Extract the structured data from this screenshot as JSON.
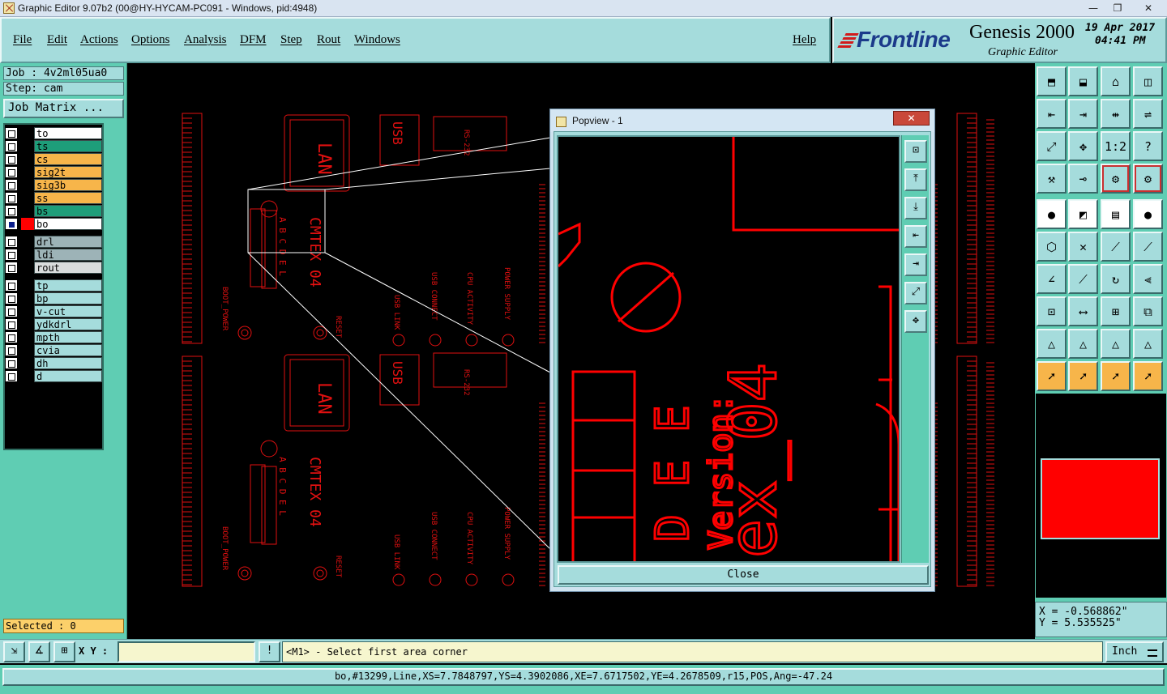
{
  "window": {
    "title": "Graphic Editor 9.07b2 (00@HY-HYCAM-PC091 - Windows, pid:4948)",
    "minimize_glyph": "—",
    "restore_glyph": "❐",
    "close_glyph": "✕"
  },
  "menu": {
    "items": [
      "File",
      "Edit",
      "Actions",
      "Options",
      "Analysis",
      "DFM",
      "Step",
      "Rout",
      "Windows"
    ],
    "help": "Help"
  },
  "brand": {
    "logo": "Frontline",
    "product": "Genesis 2000",
    "subtitle": "Graphic Editor",
    "date": "19 Apr 2017",
    "time": "04:41 PM"
  },
  "left": {
    "job": "Job : 4v2ml05ua0",
    "step": "Step: cam",
    "job_matrix": "Job Matrix ...",
    "layers": [
      {
        "name": "to",
        "color": "#ffffff"
      },
      {
        "name": "ts",
        "color": "#1e9e7a"
      },
      {
        "name": "cs",
        "color": "#f7b54a"
      },
      {
        "name": "sig2t",
        "color": "#f7b54a"
      },
      {
        "name": "sig3b",
        "color": "#f7b54a"
      },
      {
        "name": "ss",
        "color": "#f7b54a"
      },
      {
        "name": "bs",
        "color": "#1e9e7a"
      },
      {
        "name": "bo",
        "color": "#ffffff",
        "active": true
      },
      {
        "name": "drl",
        "color": "#9db3b7"
      },
      {
        "name": "ldi",
        "color": "#9db3b7"
      },
      {
        "name": "rout",
        "color": "#d9dcdc"
      },
      {
        "name": "tp",
        "color": "#a5dcdc"
      },
      {
        "name": "bp",
        "color": "#a5dcdc"
      },
      {
        "name": "v-cut",
        "color": "#a5dcdc"
      },
      {
        "name": "ydkdrl",
        "color": "#a5dcdc"
      },
      {
        "name": "mpth",
        "color": "#a5dcdc"
      },
      {
        "name": "cvia",
        "color": "#a5dcdc"
      },
      {
        "name": "dh",
        "color": "#a5dcdc"
      },
      {
        "name": "d",
        "color": "#a5dcdc"
      }
    ],
    "selected": "Selected : 0"
  },
  "popview": {
    "title": "Popview - 1",
    "close_label": "Close",
    "tools": [
      "⊡",
      "⤒",
      "⤓",
      "⇤",
      "⇥",
      "⤢",
      "✥"
    ]
  },
  "canvas": {
    "labels": {
      "lan": "LAN",
      "usb": "USB",
      "rs232": "RS-232",
      "cmtex": "CMTEX 04",
      "abcdel": "A B C D E L",
      "usb_link": "USB LINK",
      "usb_connect": "USB CONNECT",
      "cpu_activity": "CPU ACTIVITY",
      "power_supply": "POWER SUPPLY",
      "boot_power": "BOOT_POWER",
      "reset": "RESET",
      "version": "Version:",
      "zoom_text": "ex_04",
      "zoom_de": "D E E"
    }
  },
  "right_tools": {
    "rows": [
      [
        "⬒",
        "⬓",
        "⌂",
        "◫"
      ],
      [
        "⇤",
        "⇥",
        "⇹",
        "⇌"
      ],
      [
        "⤢",
        "✥",
        "1:2",
        "?"
      ],
      [
        "⚒",
        "⊸",
        "⚙",
        "⚙"
      ],
      [
        "●",
        "◩",
        "▤",
        "●"
      ],
      [
        "⬡",
        "✕",
        "⟋",
        "⟋"
      ],
      [
        "∠",
        "⟋",
        "↻",
        "⫷"
      ],
      [
        "⊡",
        "⟷",
        "⊞",
        "⧉"
      ],
      [
        "△",
        "△",
        "△",
        "△"
      ],
      [
        "➚",
        "➚",
        "➚",
        "➚"
      ]
    ],
    "swatch_color": "#ff0000"
  },
  "coords": {
    "x": "X = -0.568862\"",
    "y": "Y = 5.535525\""
  },
  "command": {
    "xy_label": "X Y :",
    "input_value": "",
    "message": "<M1> - Select first area corner",
    "unit": "Inch"
  },
  "status": {
    "text": "bo,#13299,Line,XS=7.7848797,YS=4.3902086,XE=7.6717502,YE=4.2678509,r15,POS,Ang=-47.24"
  }
}
